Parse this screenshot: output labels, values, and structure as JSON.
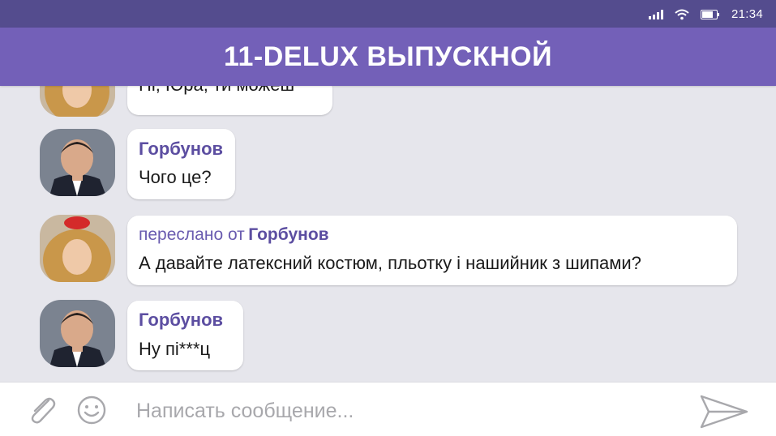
{
  "status_bar": {
    "time": "21:34",
    "icons": [
      "signal-icon",
      "wifi-icon",
      "battery-icon"
    ]
  },
  "header": {
    "title": "11-DELUX ВЫПУСКНОЙ"
  },
  "messages": [
    {
      "sender": "",
      "text": "Ні, Юра, ти можеш",
      "avatar": "female-avatar"
    },
    {
      "sender": "Горбунов",
      "text": "Чого це?",
      "avatar": "male-avatar"
    },
    {
      "forwarded_label": "переслано от",
      "forwarded_from": "Горбунов",
      "text": "А давайте латексний костюм, пльотку і нашийник з шипами?",
      "avatar": "female-avatar"
    },
    {
      "sender": "Горбунов",
      "text": "Ну пі***ц",
      "avatar": "male-avatar"
    }
  ],
  "composer": {
    "placeholder": "Написать сообщение...",
    "icons": [
      "paperclip-icon",
      "smiley-icon",
      "send-icon"
    ]
  },
  "colors": {
    "header": "#7360b8",
    "status_bar": "#544c8e",
    "sender_name": "#5c4ea1",
    "chat_background": "#e6e6ec"
  }
}
